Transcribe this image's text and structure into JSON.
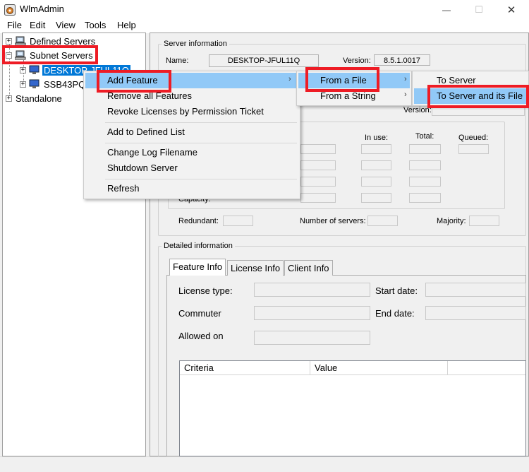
{
  "window": {
    "title": "WlmAdmin"
  },
  "menubar": [
    "File",
    "Edit",
    "View",
    "Tools",
    "Help"
  ],
  "tree": {
    "defined_servers": "Defined Servers",
    "subnet_servers": "Subnet Servers",
    "desktop": "DESKTOP-JFUL11Q",
    "ssb": "SSB43PQ",
    "standalone": "Standalone",
    "expand_plus": "+",
    "expand_minus": "−"
  },
  "server_info": {
    "group_title": "Server information",
    "name_label": "Name:",
    "name_value": "DESKTOP-JFUL11Q",
    "version_label": "Version:",
    "version_value": "8.5.1.0017",
    "version_label2": "Version:",
    "in_use": "In use:",
    "total": "Total:",
    "queued": "Queued:",
    "capacity": "Capacity:",
    "redundant": "Redundant:",
    "num_servers": "Number of servers:",
    "majority": "Majority:"
  },
  "detailed": {
    "group_title": "Detailed information",
    "tabs": [
      "Feature Info",
      "License Info",
      "Client Info"
    ],
    "license_type": "License type:",
    "start_date": "Start date:",
    "commuter": "Commuter",
    "end_date": "End date:",
    "allowed_on": "Allowed on",
    "columns": [
      "Criteria",
      "Value"
    ]
  },
  "context_menu": {
    "items": [
      "Add Feature",
      "Remove all Features",
      "Revoke Licenses by Permission Ticket",
      "Add to Defined List",
      "Change Log Filename",
      "Shutdown Server",
      "Refresh"
    ]
  },
  "submenu_add_feature": [
    "From a File",
    "From a String"
  ],
  "submenu_from_file": [
    "To Server",
    "To Server and its File"
  ],
  "icons": {
    "submenu_arrow": "›",
    "close": "✕",
    "minimize": "—",
    "maximize": "☐"
  },
  "colors": {
    "highlight": "#91c9f7",
    "selection": "#0078d7",
    "annotation_red": "#ee1c25"
  }
}
